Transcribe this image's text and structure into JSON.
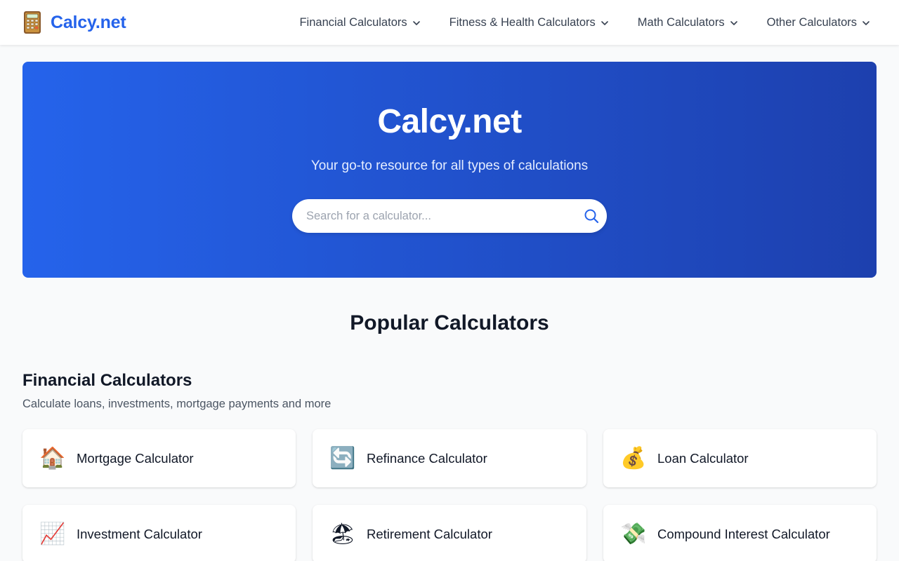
{
  "header": {
    "logo_text": "Calcy.net",
    "nav": [
      {
        "label": "Financial Calculators",
        "icon": "chevron-down-icon"
      },
      {
        "label": "Fitness & Health Calculators",
        "icon": "chevron-down-icon"
      },
      {
        "label": "Math Calculators",
        "icon": "chevron-down-icon"
      },
      {
        "label": "Other Calculators",
        "icon": "chevron-down-icon"
      }
    ]
  },
  "hero": {
    "title": "Calcy.net",
    "subtitle": "Your go-to resource for all types of calculations",
    "search_placeholder": "Search for a calculator...",
    "search_icon": "search-icon"
  },
  "popular": {
    "title": "Popular Calculators",
    "sections": [
      {
        "title": "Financial Calculators",
        "description": "Calculate loans, investments, mortgage payments and more",
        "cards": [
          {
            "label": "Mortgage Calculator",
            "icon": "house-icon",
            "glyph": "🏠"
          },
          {
            "label": "Refinance Calculator",
            "icon": "refresh-arrows-icon",
            "glyph": "🔄"
          },
          {
            "label": "Loan Calculator",
            "icon": "money-bag-icon",
            "glyph": "💰"
          },
          {
            "label": "Investment Calculator",
            "icon": "chart-increasing-icon",
            "glyph": "📈"
          },
          {
            "label": "Retirement Calculator",
            "icon": "beach-umbrella-icon",
            "glyph": "🏖"
          },
          {
            "label": "Compound Interest Calculator",
            "icon": "money-with-wings-icon",
            "glyph": "💸"
          }
        ]
      }
    ]
  },
  "colors": {
    "brand": "#2563eb",
    "hero_gradient_start": "#2563eb",
    "hero_gradient_end": "#1d40ae",
    "page_background": "#f9fafb"
  }
}
